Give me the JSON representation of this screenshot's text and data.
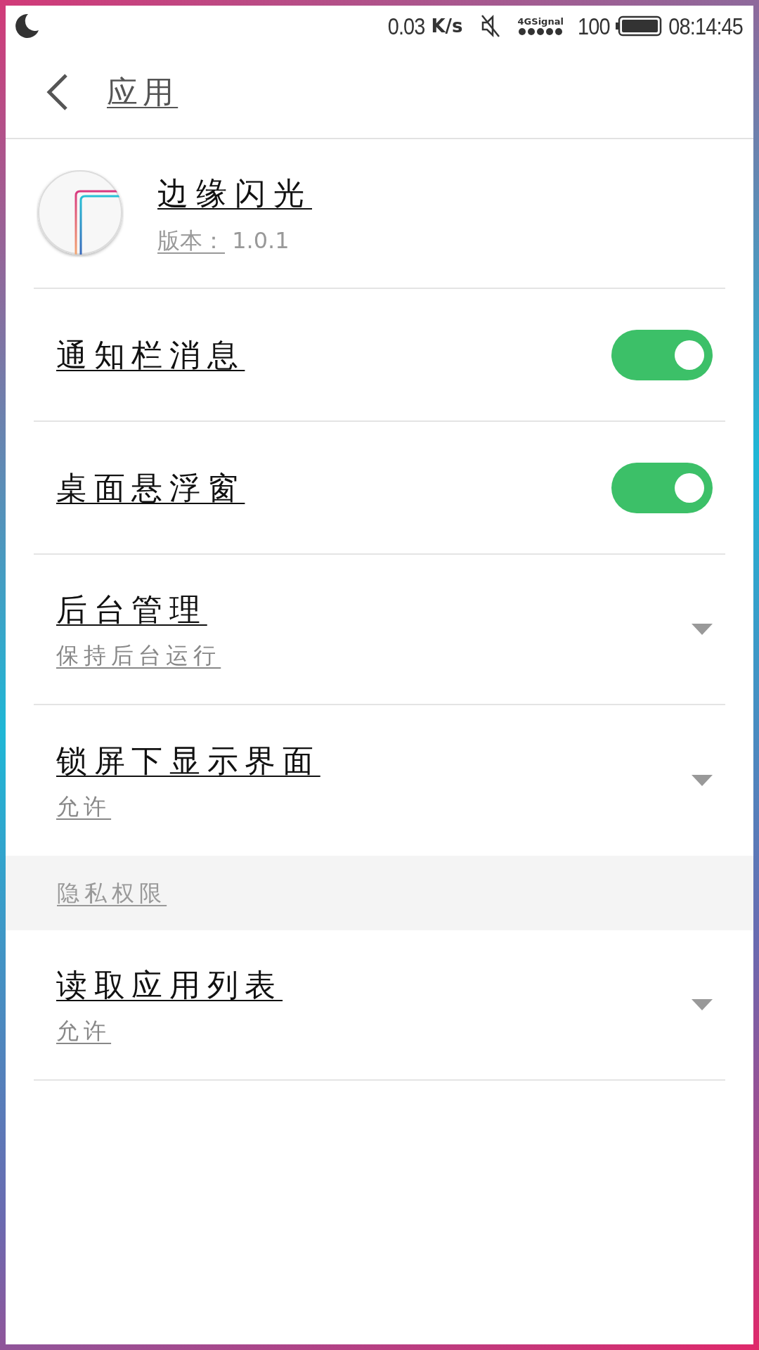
{
  "status_bar": {
    "speed": "0.03",
    "speed_unit": "K/s",
    "network": "4G",
    "signal_label": "Signal",
    "battery": "100",
    "time": "08:14:45"
  },
  "header": {
    "title": "应用"
  },
  "app": {
    "name": "边缘闪光",
    "version_label": "版本：",
    "version": "1.0.1"
  },
  "settings": [
    {
      "kind": "toggle",
      "label": "通知栏消息",
      "on": true
    },
    {
      "kind": "toggle",
      "label": "桌面悬浮窗",
      "on": true
    },
    {
      "kind": "dropdown",
      "label": "后台管理",
      "value": "保持后台运行"
    },
    {
      "kind": "dropdown",
      "label": "锁屏下显示界面",
      "value": "允许"
    }
  ],
  "privacy": {
    "title": "隐私权限",
    "settings": [
      {
        "kind": "dropdown",
        "label": "读取应用列表",
        "value": "允许"
      }
    ]
  }
}
